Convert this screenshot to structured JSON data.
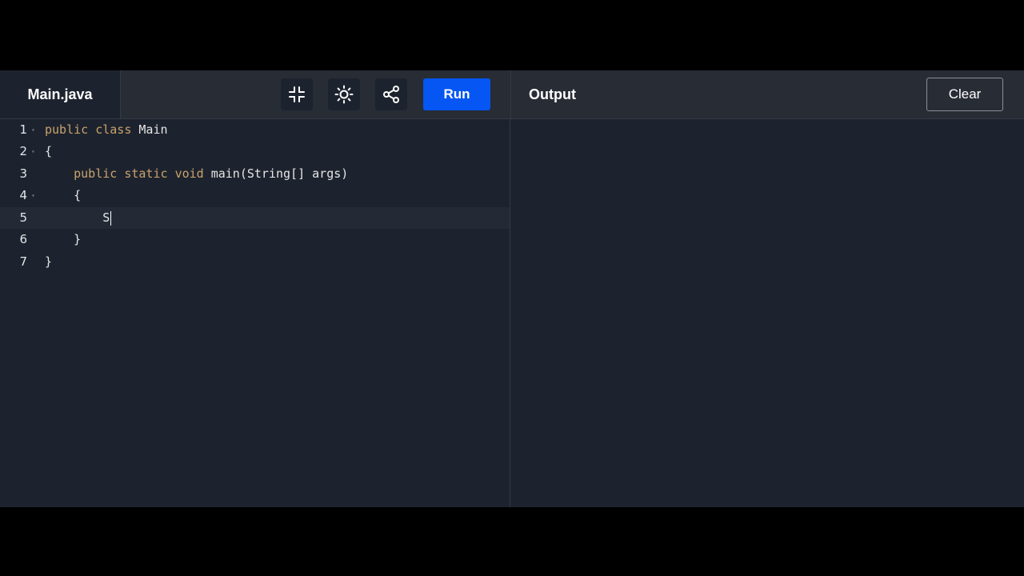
{
  "editor": {
    "file_tab": "Main.java",
    "lines": [
      {
        "number": "1",
        "tokens": [
          {
            "text": "public",
            "kind": "kw"
          },
          {
            "text": " "
          },
          {
            "text": "class",
            "kind": "kw"
          },
          {
            "text": " Main"
          }
        ]
      },
      {
        "number": "2",
        "tokens": [
          {
            "text": "{"
          }
        ]
      },
      {
        "number": "3",
        "tokens": [
          {
            "text": "    "
          },
          {
            "text": "public",
            "kind": "kw"
          },
          {
            "text": " "
          },
          {
            "text": "static",
            "kind": "kw"
          },
          {
            "text": " "
          },
          {
            "text": "void",
            "kind": "kw"
          },
          {
            "text": " main(String[] args)"
          }
        ]
      },
      {
        "number": "4",
        "tokens": [
          {
            "text": "    {"
          }
        ]
      },
      {
        "number": "5",
        "tokens": [
          {
            "text": "        S"
          }
        ]
      },
      {
        "number": "6",
        "tokens": [
          {
            "text": "    }"
          }
        ]
      },
      {
        "number": "7",
        "tokens": [
          {
            "text": "}"
          }
        ]
      }
    ],
    "active_line": 5
  },
  "toolbar": {
    "exit_fullscreen_icon": "compress-icon",
    "theme_icon": "sun-icon",
    "share_icon": "share-icon",
    "run_label": "Run"
  },
  "output": {
    "title": "Output",
    "clear_label": "Clear",
    "content": ""
  },
  "colors": {
    "run_button": "#0556f3",
    "keyword": "#c9a26d",
    "background": "#1d232e",
    "toolbar": "#272c35"
  }
}
